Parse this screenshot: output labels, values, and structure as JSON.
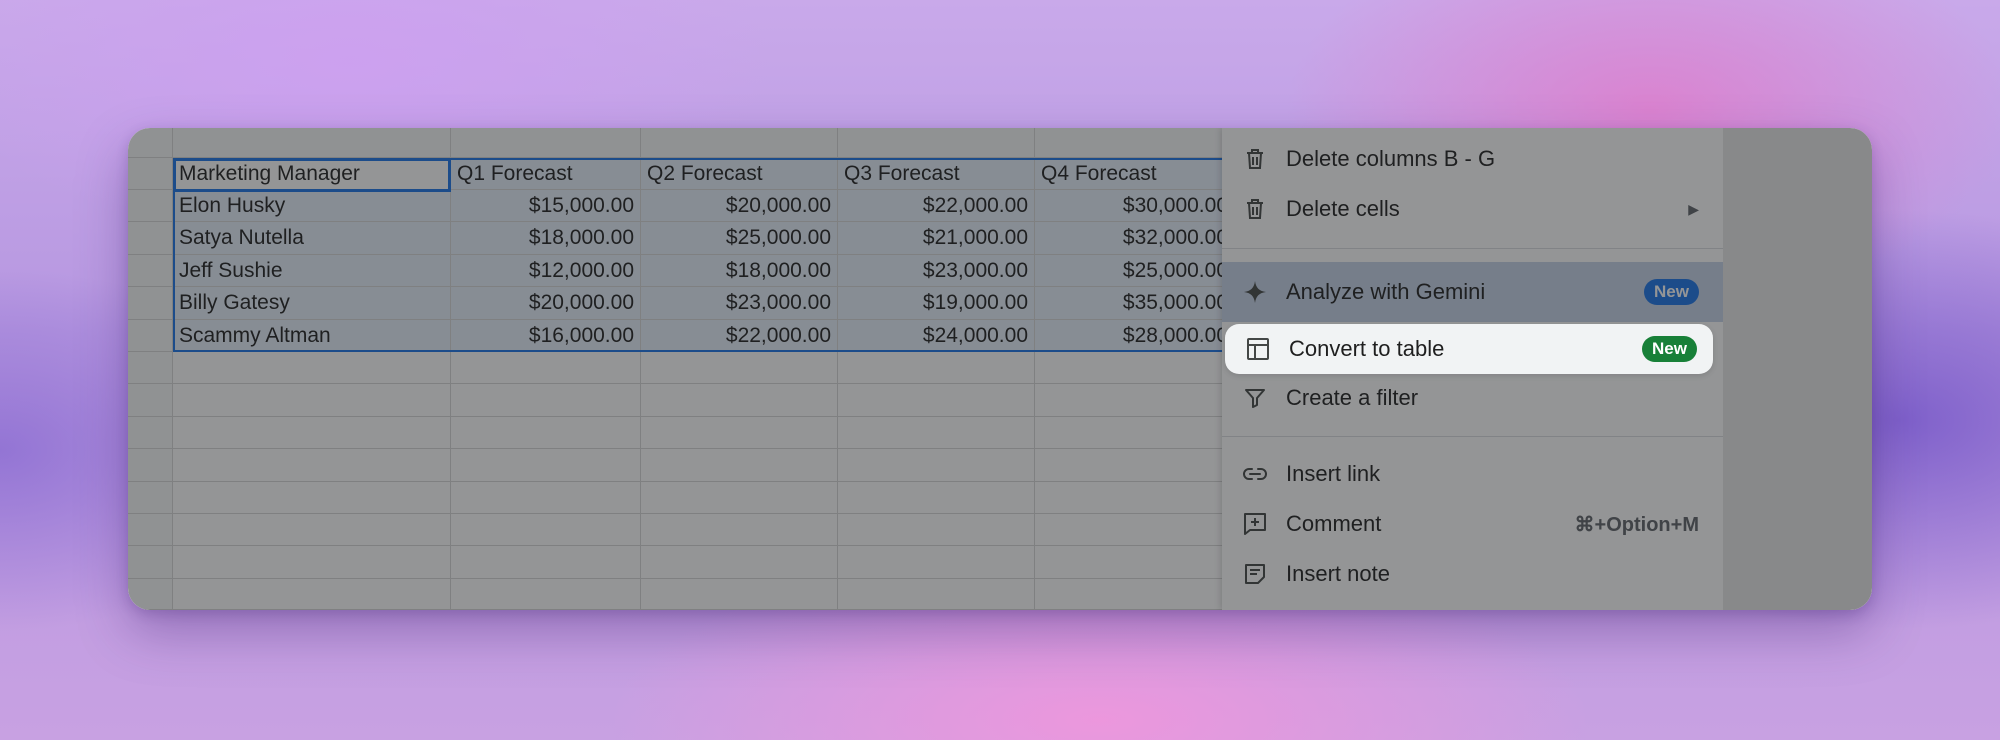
{
  "sheet": {
    "header": [
      "Marketing Manager",
      "Q1 Forecast",
      "Q2 Forecast",
      "Q3 Forecast",
      "Q4 Forecast"
    ],
    "rows": [
      [
        "Elon Husky",
        "$15,000.00",
        "$20,000.00",
        "$22,000.00",
        "$30,000.00"
      ],
      [
        "Satya Nutella",
        "$18,000.00",
        "$25,000.00",
        "$21,000.00",
        "$32,000.00"
      ],
      [
        "Jeff Sushie",
        "$12,000.00",
        "$18,000.00",
        "$23,000.00",
        "$25,000.00"
      ],
      [
        "Billy Gatesy",
        "$20,000.00",
        "$23,000.00",
        "$19,000.00",
        "$35,000.00"
      ],
      [
        "Scammy Altman",
        "$16,000.00",
        "$22,000.00",
        "$24,000.00",
        "$28,000.00"
      ]
    ]
  },
  "menu": {
    "delete_columns": "Delete columns B - G",
    "delete_cells": "Delete cells",
    "analyze_gemini": "Analyze with Gemini",
    "analyze_badge": "New",
    "convert_table": "Convert to table",
    "convert_badge": "New",
    "create_filter": "Create a filter",
    "insert_link": "Insert link",
    "comment": "Comment",
    "comment_shortcut": "⌘+Option+M",
    "insert_note": "Insert note"
  },
  "icons": {
    "delete_columns": "trash-icon",
    "delete_cells": "trash-icon",
    "submenu": "submenu-arrow-icon",
    "analyze_gemini": "sparkle-icon",
    "convert_table": "table-icon",
    "create_filter": "filter-icon",
    "insert_link": "link-icon",
    "comment": "add-comment-icon",
    "insert_note": "note-icon"
  },
  "colors": {
    "selection_border": "#1a73e8",
    "badge_blue": "#1a73e8",
    "badge_green": "#188038"
  }
}
